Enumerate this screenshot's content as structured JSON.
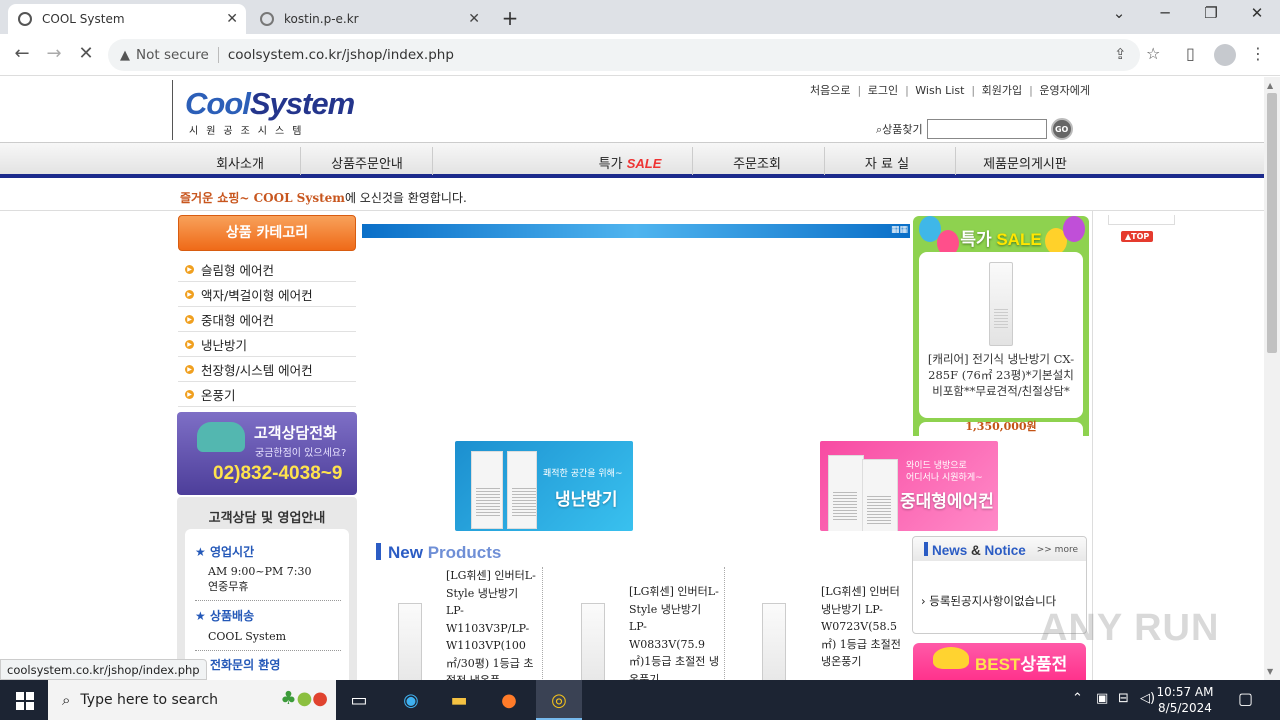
{
  "browser": {
    "tabs": [
      {
        "title": "COOL System",
        "active": true
      },
      {
        "title": "kostin.p-e.kr",
        "active": false
      }
    ],
    "security": "Not secure",
    "url": "coolsystem.co.kr/jshop/index.php",
    "status_url": "coolsystem.co.kr/jshop/index.php"
  },
  "site": {
    "logo": {
      "part1": "Cool",
      "part2": "System",
      "sub": "시원공조시스템"
    },
    "top_links": [
      "처음으로",
      "로그인",
      "Wish List",
      "회원가입",
      "운영자에게"
    ],
    "search": {
      "label": "상품찾기",
      "placeholder": "",
      "go": "GO"
    },
    "nav": {
      "company": "회사소개",
      "order_guide": "상품주문안내",
      "special_prefix": "특가",
      "special_sale": "SALE",
      "order_check": "주문조회",
      "archive": "자 료 실",
      "board": "제품문의게시판"
    },
    "welcome": {
      "highlight": "즐거운 쇼핑~ COOL System",
      "rest": "에 오신것을 환영합니다."
    },
    "category": {
      "title": "상품 카테고리",
      "items": [
        "슬림형 에어컨",
        "액자/벽걸이형 에어컨",
        "중대형 에어컨",
        "냉난방기",
        "천장형/시스템 에어컨",
        "온풍기"
      ]
    },
    "call": {
      "title": "고객상담전화",
      "subtitle": "궁금한점이 있으세요?",
      "number": "02)832-4038~9"
    },
    "info": {
      "title": "고객상담 및 영업안내",
      "hours_label": "영업시간",
      "hours_1": "AM 9:00~PM 7:30",
      "hours_2": "연중무휴",
      "delivery_label": "상품배송",
      "delivery_value": "COOL System",
      "phone_label": "전화문의 환영"
    },
    "special": {
      "title_prefix": "특가",
      "title_sale": "SALE",
      "desc": "[캐리어] 전기식 냉난방기 CX-285F (76㎡ 23평)*기본설치비포함**무료견적/친절상담*",
      "price": "1,350,000원"
    },
    "promos": [
      {
        "small": "쾌적한 공간을 위해~",
        "big": "냉난방기"
      },
      {
        "small1": "와이드 냉방으로",
        "small2": "어디서나 시원하게~",
        "big": "중대형에어컨"
      }
    ],
    "new_products": {
      "title_new": "New",
      "title_products": "Products",
      "items": [
        "[LG휘센] 인버터L-Style 냉난방기 LP-W1103V3P/LP-W1103VP(100㎡/30평) 1등급 초절전 냉온풍",
        "[LG휘센] 인버터L-Style 냉난방기 LP-W0833V(75.9㎡)1등급 초절전 냉온풍기",
        "[LG휘센] 인버터 냉난방기 LP-W0723V(58.5㎡) 1등급 초절전 냉온풍기"
      ]
    },
    "news": {
      "title_a": "News",
      "title_amp": " & ",
      "title_b": "Notice",
      "more": ">> more",
      "empty": "등록된공지사항이없습니다"
    },
    "best": {
      "title_best": "BEST",
      "title_rest": "상품전"
    },
    "top_button": "TOP",
    "watermark": "ANY RUN"
  },
  "taskbar": {
    "search_placeholder": "Type here to search",
    "time": "10:57 AM",
    "date": "8/5/2024"
  }
}
